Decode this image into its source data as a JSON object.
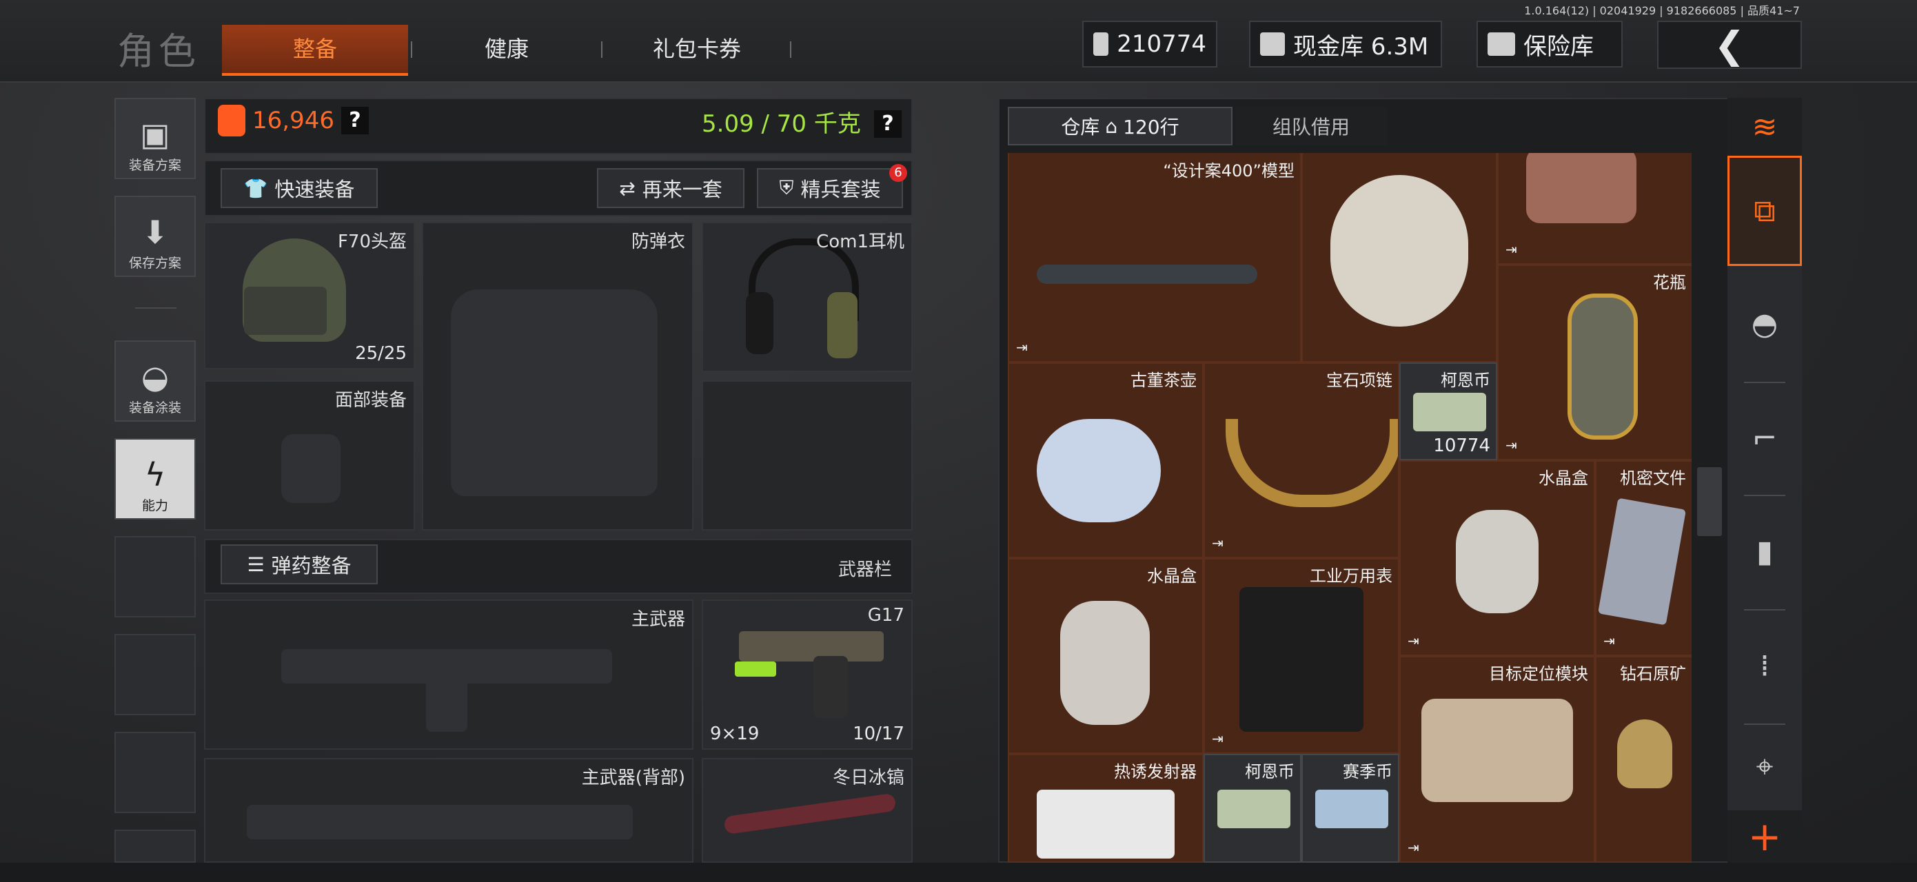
{
  "header": {
    "version": "1.0.164(12) | 02041929 | 9182666085 | 品质41~7",
    "title": "角色",
    "tabs": [
      {
        "label": "整备",
        "active": true
      },
      {
        "label": "健康",
        "active": false
      },
      {
        "label": "礼包卡券",
        "active": false
      }
    ],
    "currency": {
      "value": "210774",
      "icon": "cash-icon"
    },
    "cash_vault": {
      "label": "现金库 6.3M",
      "icon": "vault-icon"
    },
    "safe_box": {
      "label": "保险库",
      "icon": "safe-icon"
    },
    "back_icon": "chevron-left-icon"
  },
  "left_menu": [
    {
      "label": "装备方案",
      "icon": "vest-icon"
    },
    {
      "label": "保存方案",
      "icon": "download-icon"
    },
    {
      "label": "装备涂装",
      "icon": "helmet-paint-icon"
    },
    {
      "label": "能力",
      "icon": "lightning-icon",
      "selected": true
    }
  ],
  "loadout": {
    "armor_value": "16,946",
    "weight": "5.09 / 70 千克",
    "help": "?",
    "quick_equip": "快速装备",
    "again": "再来一套",
    "elite": "精兵套装",
    "elite_badge": "6",
    "ammo_equip": "弹药整备",
    "weapons_label": "武器栏",
    "slots": {
      "helmet": {
        "label": "F70头盔",
        "value": "25/25"
      },
      "face": {
        "label": "面部装备"
      },
      "vest": {
        "label": "防弹衣"
      },
      "headset": {
        "label": "Com1耳机"
      },
      "primary": {
        "label": "主武器"
      },
      "pistol": {
        "label": "G17",
        "ammo": "9×19",
        "count": "10/17"
      },
      "primary_back": {
        "label": "主武器(背部)"
      },
      "melee": {
        "label": "冬日冰镐"
      }
    }
  },
  "warehouse": {
    "tab_storage": "仓库",
    "tab_rows": "120行",
    "tab_team": "组队借用",
    "items": [
      {
        "name": "“设计案400”模型"
      },
      {
        "name": ""
      },
      {
        "name": "花瓶"
      },
      {
        "name": "古董茶壶"
      },
      {
        "name": "宝石项链"
      },
      {
        "name": "柯恩币",
        "count": "10774"
      },
      {
        "name": "水晶盒"
      },
      {
        "name": "机密文件"
      },
      {
        "name": "水晶盒"
      },
      {
        "name": "工业万用表"
      },
      {
        "name": "目标定位模块"
      },
      {
        "name": "钻石原矿"
      },
      {
        "name": "热诱发射器"
      },
      {
        "name": "柯恩币"
      },
      {
        "name": "赛季币"
      }
    ],
    "mark": "⇥"
  },
  "colors": {
    "accent": "#ff6a1a",
    "armor": "#ff6a28",
    "weight": "#a7e545",
    "grid_bg": "#4a2616"
  },
  "right_tools": [
    {
      "icon": "layers-refresh-icon"
    },
    {
      "icon": "layers-upload-icon",
      "selected": true
    },
    {
      "icon": "helmet-icon"
    },
    {
      "icon": "rifle-icon"
    },
    {
      "icon": "magazine-icon"
    },
    {
      "icon": "bullet-icon"
    },
    {
      "icon": "scope-icon"
    },
    {
      "icon": "plus-icon"
    }
  ]
}
